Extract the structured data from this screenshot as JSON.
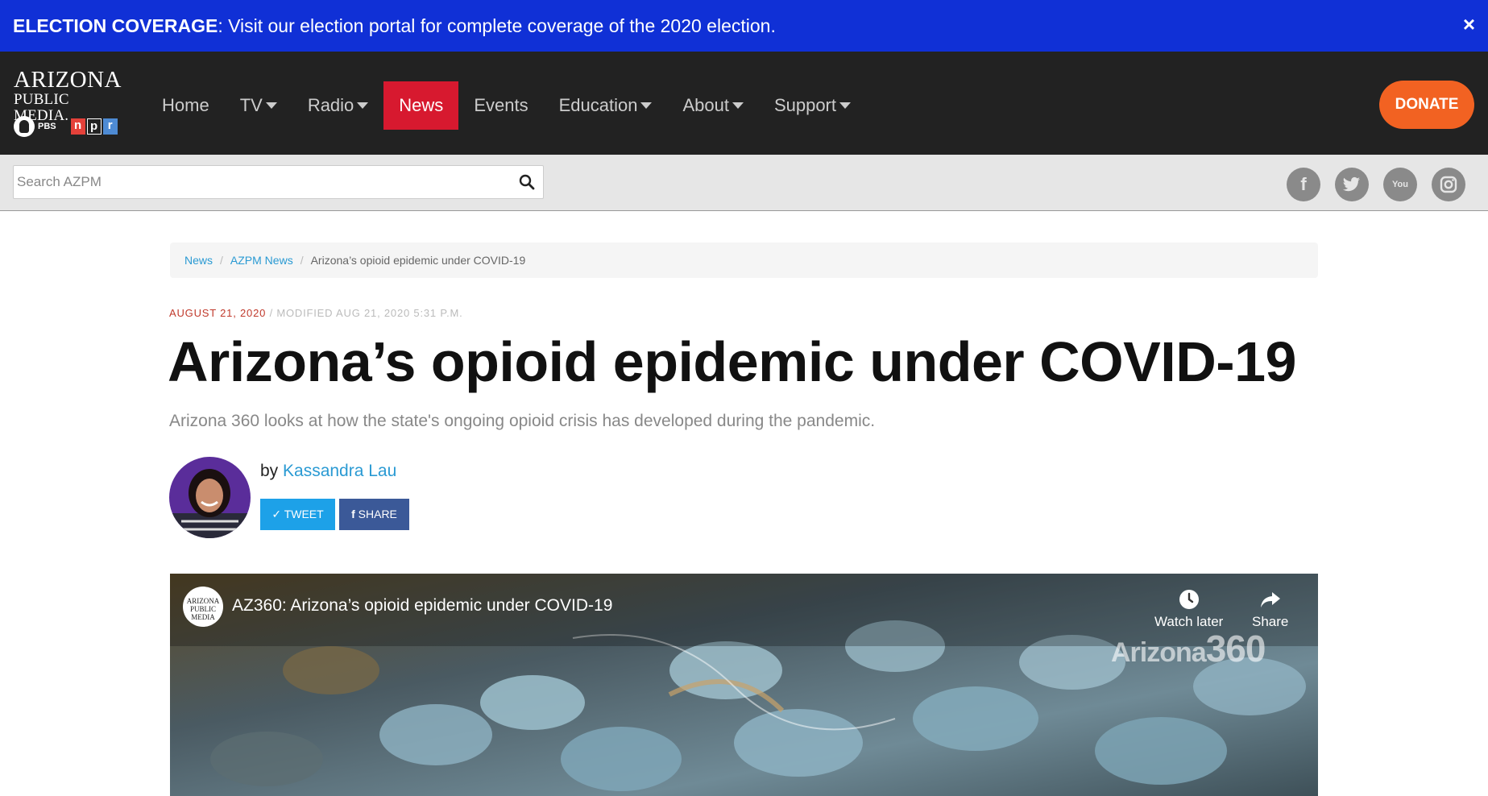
{
  "banner": {
    "label": "ELECTION COVERAGE",
    "text": ": Visit our election portal for complete coverage of the 2020 election.",
    "close": "×"
  },
  "logo": {
    "line1": "ARIZONA",
    "line2": "PUBLIC MEDIA.",
    "pbs": "PBS",
    "npr": [
      "n",
      "p",
      "r"
    ]
  },
  "nav": {
    "items": [
      {
        "label": "Home",
        "dropdown": false,
        "active": false
      },
      {
        "label": "TV",
        "dropdown": true,
        "active": false
      },
      {
        "label": "Radio",
        "dropdown": true,
        "active": false
      },
      {
        "label": "News",
        "dropdown": false,
        "active": true
      },
      {
        "label": "Events",
        "dropdown": false,
        "active": false
      },
      {
        "label": "Education",
        "dropdown": true,
        "active": false
      },
      {
        "label": "About",
        "dropdown": true,
        "active": false
      },
      {
        "label": "Support",
        "dropdown": true,
        "active": false
      }
    ],
    "donate": "DONATE"
  },
  "search": {
    "placeholder": "Search AZPM",
    "value": ""
  },
  "social": [
    "f",
    "t",
    "You",
    "ig"
  ],
  "breadcrumb": {
    "items": [
      "News",
      "AZPM News"
    ],
    "current": "Arizona’s opioid epidemic under COVID-19",
    "separator": "/"
  },
  "article": {
    "date": "AUGUST 21, 2020",
    "modified": " / MODIFIED AUG 21, 2020 5:31 P.M.",
    "title": "Arizona’s opioid epidemic under COVID-19",
    "subtitle": "Arizona 360 looks at how the state's ongoing opioid crisis has developed during the pandemic.",
    "by": "by ",
    "author": "Kassandra Lau",
    "tweet": "TWEET",
    "share": "SHARE"
  },
  "video": {
    "title": "AZ360: Arizona’s opioid epidemic under COVID-19",
    "channel_line1": "ARIZONA",
    "channel_line2": "PUBLIC MEDIA",
    "watch_later": "Watch later",
    "share": "Share",
    "watermark_word": "Arizona",
    "watermark_num": "360"
  },
  "colors": {
    "banner": "#1030d6",
    "nav_bg": "#222222",
    "news_active": "#d7192f",
    "donate": "#f26222",
    "link": "#2a9ad3",
    "twitter": "#1da1e8",
    "facebook": "#3b5998"
  }
}
